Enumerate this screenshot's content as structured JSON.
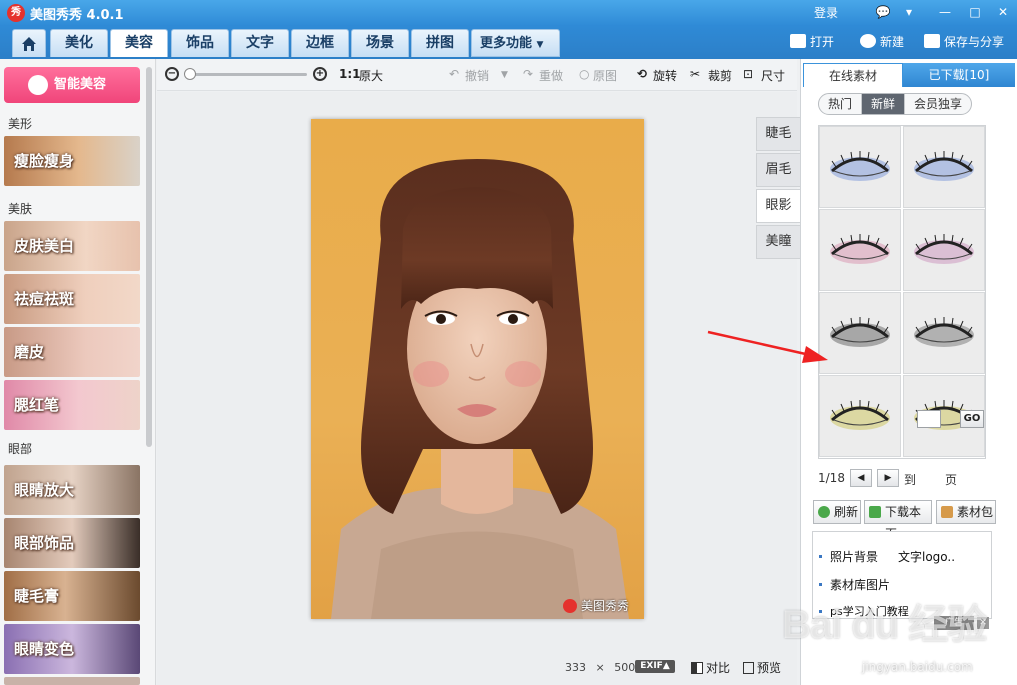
{
  "app": {
    "title": "美图秀秀 4.0.1",
    "logo_char": "秀",
    "login": "登录"
  },
  "window_controls": [
    {
      "name": "feedback-icon",
      "glyph": "💬"
    },
    {
      "name": "skin-icon",
      "glyph": "▾"
    },
    {
      "name": "minimize-icon",
      "glyph": "—"
    },
    {
      "name": "maximize-icon",
      "glyph": "□"
    },
    {
      "name": "close-icon",
      "glyph": "✕"
    }
  ],
  "tabs": [
    {
      "label": "美化",
      "active": false
    },
    {
      "label": "美容",
      "active": true
    },
    {
      "label": "饰品",
      "active": false
    },
    {
      "label": "文字",
      "active": false
    },
    {
      "label": "边框",
      "active": false
    },
    {
      "label": "场景",
      "active": false
    },
    {
      "label": "拼图",
      "active": false
    }
  ],
  "more_tab": "更多功能",
  "top_actions": {
    "open": "打开",
    "new": "新建",
    "save_share": "保存与分享"
  },
  "sidebar": {
    "smart_button": "智能美容",
    "sections": [
      {
        "title": "美形",
        "items": [
          "瘦脸瘦身"
        ]
      },
      {
        "title": "美肤",
        "items": [
          "皮肤美白",
          "祛痘祛斑",
          "磨皮",
          "腮红笔"
        ]
      },
      {
        "title": "眼部",
        "items": [
          "眼睛放大",
          "眼部饰品",
          "睫毛膏",
          "眼睛变色"
        ]
      }
    ]
  },
  "toolbar": {
    "one_to_one": "1:1",
    "original_size": "原大",
    "undo": "撤销",
    "redo": "重做",
    "original": "原图",
    "rotate": "旋转",
    "crop": "裁剪",
    "size": "尺寸"
  },
  "canvas": {
    "watermark": "美图秀秀",
    "width": "333",
    "times": "×",
    "height": "500",
    "exif": "EXIF▲",
    "compare": "对比",
    "preview": "预览"
  },
  "vertical_tabs": [
    {
      "label": "睫毛",
      "active": false
    },
    {
      "label": "眉毛",
      "active": false
    },
    {
      "label": "眼影",
      "active": true
    },
    {
      "label": "美瞳",
      "active": false
    }
  ],
  "right_panel": {
    "tab_online": "在线素材",
    "tab_downloaded": "已下载[10]",
    "subtabs": [
      {
        "label": "热门",
        "active": false
      },
      {
        "label": "新鲜",
        "active": true
      },
      {
        "label": "会员独享",
        "active": false
      }
    ],
    "eyeshadow_colors": [
      "#6f8fd6",
      "#6f8fd6",
      "#d68aa8",
      "#c889b8",
      "#555555",
      "#6a6a6a",
      "#c9c24a",
      "#c9c24a"
    ],
    "page_indicator": "1/18",
    "goto_label": "到",
    "page_label": "页",
    "go": "GO",
    "refresh": "刷新",
    "download_page": "下载本页",
    "material_pack": "素材包",
    "links": [
      "照片背景",
      "文字logo..",
      "素材库图片",
      "ps学习入门教程"
    ],
    "ad_tag": "广告"
  },
  "overlay": {
    "baidu_mark": "Bai du 经验",
    "baidu_url": "jingyan.baidu.com",
    "arrow_color": "#ee2222"
  }
}
